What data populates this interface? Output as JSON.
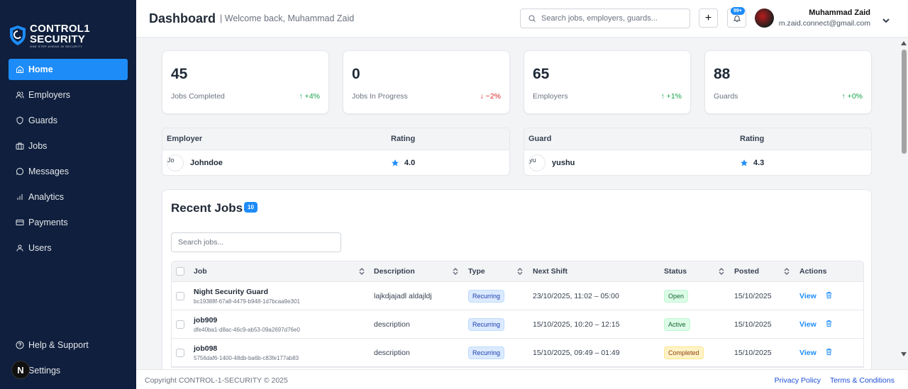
{
  "brand": {
    "line1": "CONTROL1",
    "line2": "SECURITY",
    "tagline": "ONE STEP AHEAD IN SECURITY",
    "accent": "#1d8cf8",
    "sidebar_bg": "#0f1f3d"
  },
  "sidebar": {
    "items": [
      {
        "label": "Home",
        "icon": "home-icon",
        "active": true
      },
      {
        "label": "Employers",
        "icon": "users-icon"
      },
      {
        "label": "Guards",
        "icon": "shield-icon"
      },
      {
        "label": "Jobs",
        "icon": "briefcase-icon"
      },
      {
        "label": "Messages",
        "icon": "message-icon"
      },
      {
        "label": "Analytics",
        "icon": "bar-chart-icon"
      },
      {
        "label": "Payments",
        "icon": "credit-card-icon"
      },
      {
        "label": "Users",
        "icon": "user-icon"
      }
    ],
    "bottom": [
      {
        "label": "Help & Support",
        "icon": "help-icon"
      },
      {
        "label": "Settings",
        "icon": "gear-icon"
      }
    ],
    "n_badge": "N"
  },
  "header": {
    "title": "Dashboard",
    "welcome": "| Welcome back, Muhammad Zaid",
    "search_placeholder": "Search jobs, employers, guards...",
    "plus_label": "+",
    "notif_count": "99+",
    "user_name": "Muhammad Zaid",
    "user_email": "m.zaid.connect@gmail.com"
  },
  "stats": [
    {
      "value": "45",
      "label": "Jobs Completed",
      "change": "↑ +4%",
      "trend": "up"
    },
    {
      "value": "0",
      "label": "Jobs In Progress",
      "change": "↓ −2%",
      "trend": "down"
    },
    {
      "value": "65",
      "label": "Employers",
      "change": "↑ +1%",
      "trend": "up"
    },
    {
      "value": "88",
      "label": "Guards",
      "change": "↑ +0%",
      "trend": "up"
    }
  ],
  "employer_rating": {
    "col1": "Employer",
    "col2": "Rating",
    "avatar_alt": "Jo",
    "name": "Johndoe",
    "rating": "4.0"
  },
  "guard_rating": {
    "col1": "Guard",
    "col2": "Rating",
    "avatar_alt": "yu",
    "name": "yushu",
    "rating": "4.3"
  },
  "recent_jobs": {
    "title": "Recent Jobs",
    "count": "10",
    "search_placeholder": "Search jobs...",
    "columns": [
      "Job",
      "Description",
      "Type",
      "Next Shift",
      "Status",
      "Posted",
      "Actions"
    ],
    "rows": [
      {
        "name": "Night Security Guard",
        "id": "bc19388f-67a8-4479-b948-1d7bcaa9e301",
        "description": "lajkdjajadl aldajldj",
        "type": "Recurring",
        "next_shift": "23/10/2025, 11:02 – 05:00",
        "status": "Open",
        "status_kind": "open",
        "posted": "15/10/2025",
        "action": "View"
      },
      {
        "name": "job909",
        "id": "dfe40ba1-d8ac-46c9-ab53-09a2697d76e0",
        "description": "description",
        "type": "Recurring",
        "next_shift": "15/10/2025, 10:20 – 12:15",
        "status": "Active",
        "status_kind": "active",
        "posted": "15/10/2025",
        "action": "View"
      },
      {
        "name": "job098",
        "id": "5756daf6-1400-48db-ba6b-c83fe177ab83",
        "description": "description",
        "type": "Recurring",
        "next_shift": "15/10/2025, 09:49 – 01:49",
        "status": "Completed",
        "status_kind": "completed",
        "posted": "15/10/2025",
        "action": "View"
      }
    ]
  },
  "footer": {
    "copyright": "Copyright CONTROL-1-SECURITY © 2025",
    "privacy": "Privacy Policy",
    "terms": "Terms & Conditions"
  }
}
